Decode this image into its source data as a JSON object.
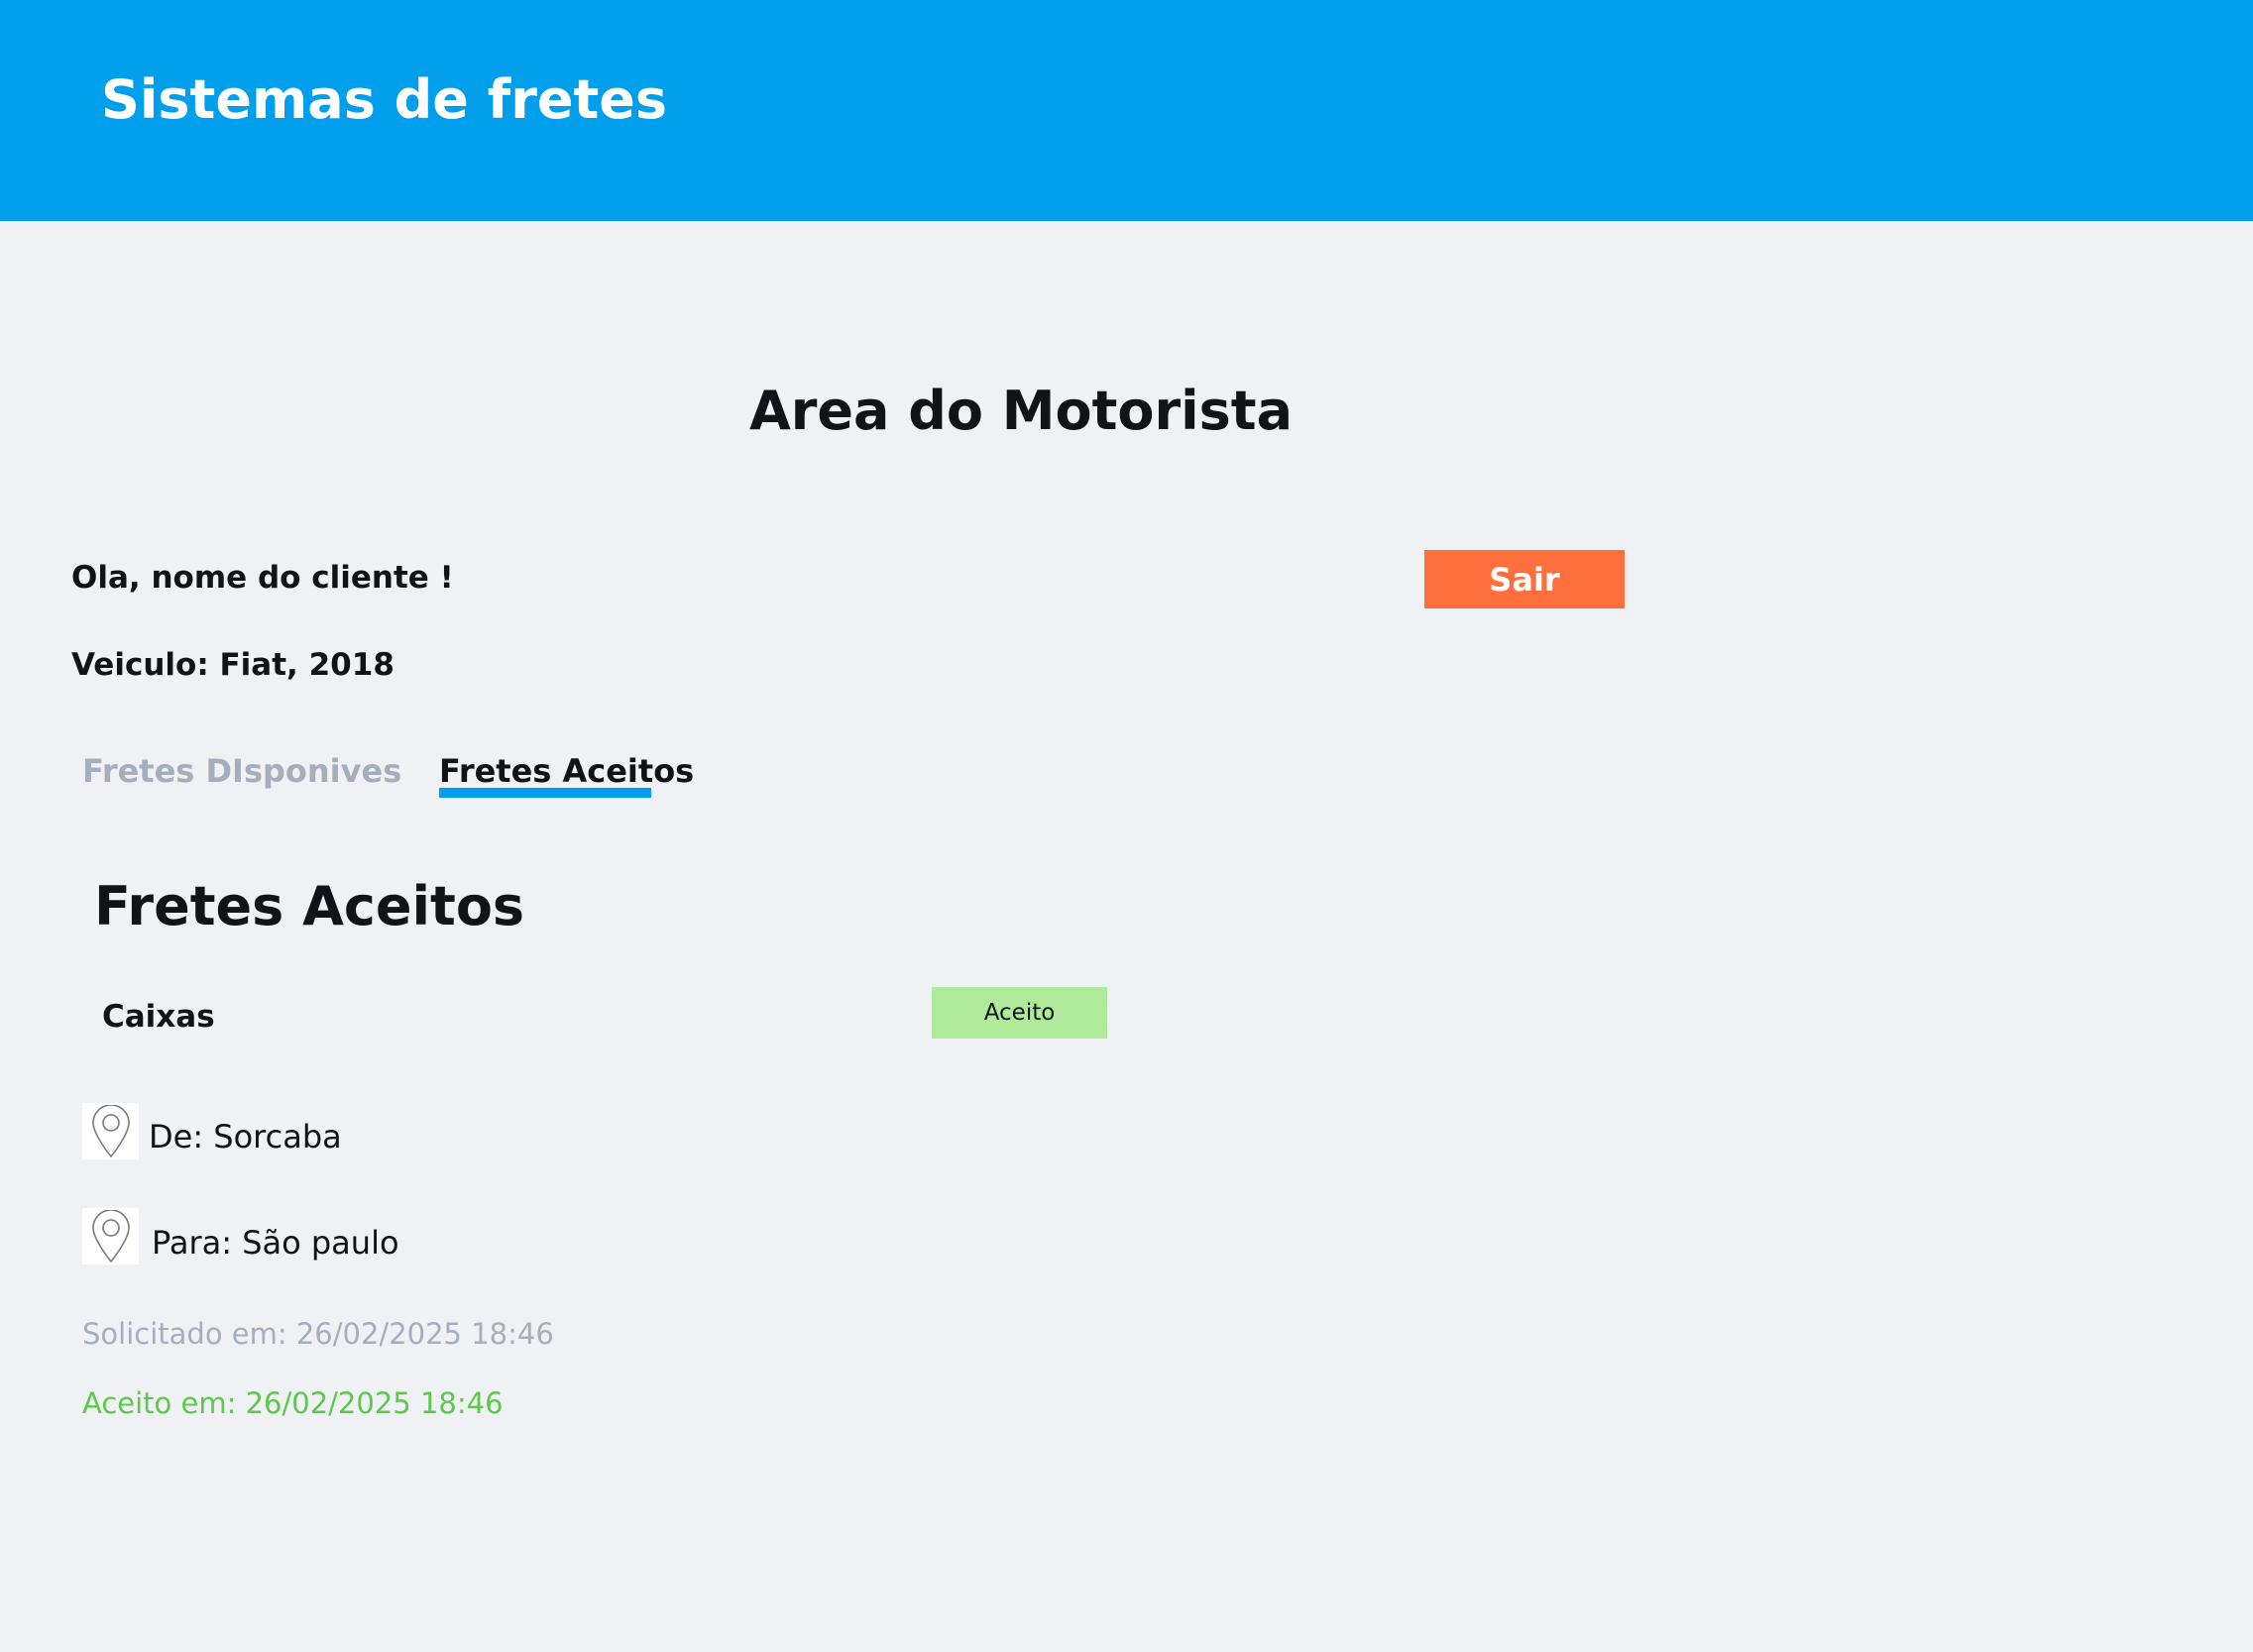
{
  "header": {
    "title": "Sistemas de fretes",
    "background_color": "#009eeb"
  },
  "page": {
    "title": "Area do Motorista"
  },
  "user": {
    "greeting": "Ola, nome do cliente !",
    "vehicle": "Veiculo: Fiat, 2018"
  },
  "actions": {
    "logout_label": "Sair",
    "logout_color": "#ff6f3d"
  },
  "tabs": [
    {
      "label": "Fretes DIsponives",
      "active": false
    },
    {
      "label": "Fretes Aceitos",
      "active": true
    }
  ],
  "section": {
    "title": "Fretes Aceitos"
  },
  "freight": {
    "cargo": "Caixas",
    "status": "Aceito",
    "status_color": "#afea9a",
    "from": "De: Sorcaba",
    "to": "Para: São paulo",
    "requested_at": "Solicitado em: 26/02/2025 18:46",
    "accepted_at": "Aceito em: 26/02/2025 18:46",
    "accepted_color": "#5cc94a",
    "from_icon": "location-pin-icon",
    "to_icon": "location-pin-icon"
  }
}
